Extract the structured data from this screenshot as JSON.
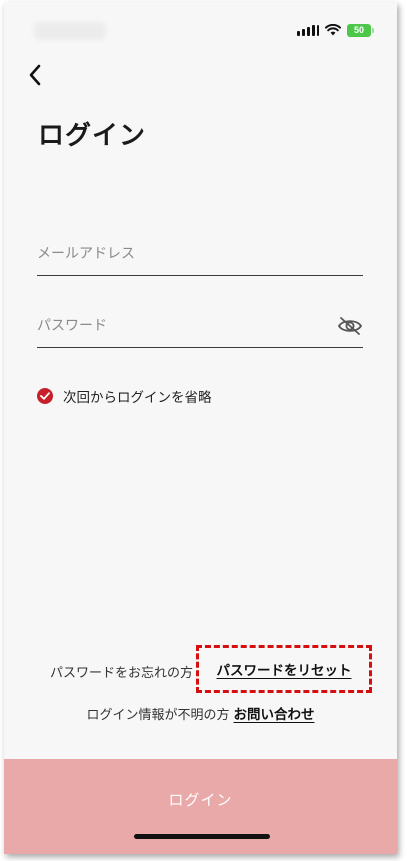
{
  "status_bar": {
    "battery_level": "50",
    "icons": [
      "signal-icon",
      "wifi-icon",
      "battery-icon"
    ]
  },
  "header": {
    "back_icon": "chevron-left-icon",
    "title": "ログイン"
  },
  "form": {
    "email": {
      "placeholder": "メールアドレス",
      "value": ""
    },
    "password": {
      "placeholder": "パスワード",
      "value": "",
      "toggle_icon": "eye-off-icon"
    },
    "remember": {
      "label": "次回からログインを省略",
      "checked": true
    }
  },
  "help": {
    "forgot_prefix": "パスワードをお忘れの方",
    "reset_link": "パスワードをリセット",
    "unknown_prefix": "ログイン情報が不明の方",
    "contact_link": "お問い合わせ"
  },
  "login_button": {
    "label": "ログイン"
  },
  "colors": {
    "accent": "#c8202a",
    "button_bg": "#eaa9a9",
    "highlight": "#d50f0f",
    "battery": "#4cc74a"
  }
}
